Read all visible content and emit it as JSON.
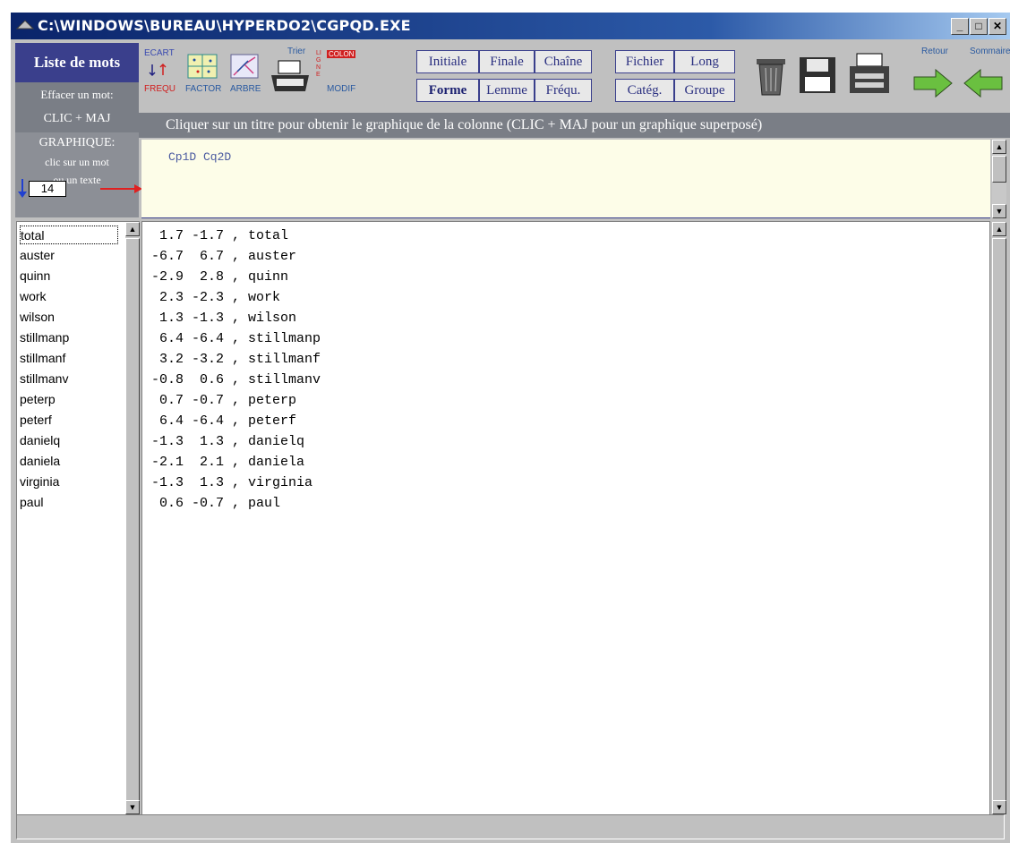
{
  "window": {
    "title": "C:\\WINDOWS\\BUREAU\\HYPERDO2\\CGPQD.EXE"
  },
  "left_panel": {
    "liste_mots": "Liste de mots",
    "effacer": "Effacer un mot:",
    "clic_maj": "CLIC + MAJ",
    "graph_title": "GRAPHIQUE:",
    "graph_line2": "clic sur un mot",
    "graph_line3": "ou un texte",
    "number": "14"
  },
  "toolbar": {
    "ecart": "ECART",
    "frequ": "FREQU",
    "factor": "FACTOR",
    "arbre": "ARBRE",
    "trier": "Trier",
    "colon": "COLON",
    "modif": "MODIF",
    "ligne": "LIGNE",
    "initiale": "Initiale",
    "finale": "Finale",
    "chaine": "Chaîne",
    "forme": "Forme",
    "lemme": "Lemme",
    "frequ2": "Fréqu.",
    "fichier": "Fichier",
    "long": "Long",
    "categ": "Catég.",
    "groupe": "Groupe",
    "retour": "Retour",
    "sommaire": "Sommaire"
  },
  "instruction": "Cliquer sur un titre pour obtenir le graphique de la colonne (CLIC + MAJ pour un graphique superposé)",
  "header_cols": "Cp1D Cq2D",
  "words": [
    "total",
    "auster",
    "quinn",
    "work",
    "wilson",
    "stillmanp",
    "stillmanf",
    "stillmanv",
    "peterp",
    "peterf",
    "danielq",
    "daniela",
    "virginia",
    "paul"
  ],
  "rows": [
    " 1.7 -1.7 , total",
    "-6.7  6.7 , auster",
    "-2.9  2.8 , quinn",
    " 2.3 -2.3 , work",
    " 1.3 -1.3 , wilson",
    " 6.4 -6.4 , stillmanp",
    " 3.2 -3.2 , stillmanf",
    "-0.8  0.6 , stillmanv",
    " 0.7 -0.7 , peterp",
    " 6.4 -6.4 , peterf",
    "-1.3  1.3 , danielq",
    "-2.1  2.1 , daniela",
    "-1.3  1.3 , virginia",
    " 0.6 -0.7 , paul"
  ]
}
